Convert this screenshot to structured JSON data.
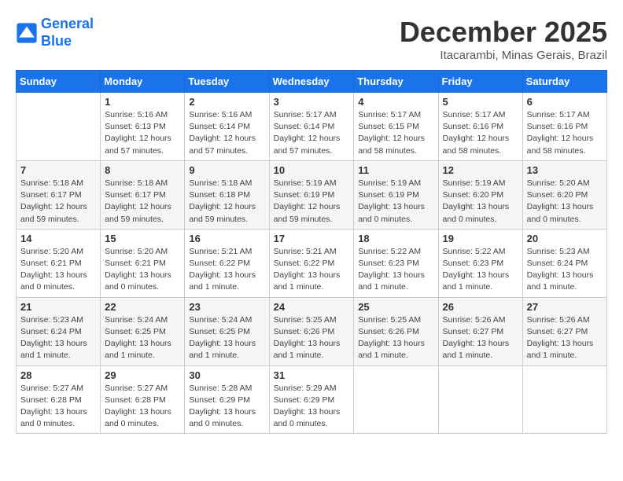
{
  "header": {
    "logo_line1": "General",
    "logo_line2": "Blue",
    "month": "December 2025",
    "location": "Itacarambi, Minas Gerais, Brazil"
  },
  "weekdays": [
    "Sunday",
    "Monday",
    "Tuesday",
    "Wednesday",
    "Thursday",
    "Friday",
    "Saturday"
  ],
  "weeks": [
    [
      {
        "day": "",
        "info": ""
      },
      {
        "day": "1",
        "info": "Sunrise: 5:16 AM\nSunset: 6:13 PM\nDaylight: 12 hours\nand 57 minutes."
      },
      {
        "day": "2",
        "info": "Sunrise: 5:16 AM\nSunset: 6:14 PM\nDaylight: 12 hours\nand 57 minutes."
      },
      {
        "day": "3",
        "info": "Sunrise: 5:17 AM\nSunset: 6:14 PM\nDaylight: 12 hours\nand 57 minutes."
      },
      {
        "day": "4",
        "info": "Sunrise: 5:17 AM\nSunset: 6:15 PM\nDaylight: 12 hours\nand 58 minutes."
      },
      {
        "day": "5",
        "info": "Sunrise: 5:17 AM\nSunset: 6:16 PM\nDaylight: 12 hours\nand 58 minutes."
      },
      {
        "day": "6",
        "info": "Sunrise: 5:17 AM\nSunset: 6:16 PM\nDaylight: 12 hours\nand 58 minutes."
      }
    ],
    [
      {
        "day": "7",
        "info": "Sunrise: 5:18 AM\nSunset: 6:17 PM\nDaylight: 12 hours\nand 59 minutes."
      },
      {
        "day": "8",
        "info": "Sunrise: 5:18 AM\nSunset: 6:17 PM\nDaylight: 12 hours\nand 59 minutes."
      },
      {
        "day": "9",
        "info": "Sunrise: 5:18 AM\nSunset: 6:18 PM\nDaylight: 12 hours\nand 59 minutes."
      },
      {
        "day": "10",
        "info": "Sunrise: 5:19 AM\nSunset: 6:19 PM\nDaylight: 12 hours\nand 59 minutes."
      },
      {
        "day": "11",
        "info": "Sunrise: 5:19 AM\nSunset: 6:19 PM\nDaylight: 13 hours\nand 0 minutes."
      },
      {
        "day": "12",
        "info": "Sunrise: 5:19 AM\nSunset: 6:20 PM\nDaylight: 13 hours\nand 0 minutes."
      },
      {
        "day": "13",
        "info": "Sunrise: 5:20 AM\nSunset: 6:20 PM\nDaylight: 13 hours\nand 0 minutes."
      }
    ],
    [
      {
        "day": "14",
        "info": "Sunrise: 5:20 AM\nSunset: 6:21 PM\nDaylight: 13 hours\nand 0 minutes."
      },
      {
        "day": "15",
        "info": "Sunrise: 5:20 AM\nSunset: 6:21 PM\nDaylight: 13 hours\nand 0 minutes."
      },
      {
        "day": "16",
        "info": "Sunrise: 5:21 AM\nSunset: 6:22 PM\nDaylight: 13 hours\nand 1 minute."
      },
      {
        "day": "17",
        "info": "Sunrise: 5:21 AM\nSunset: 6:22 PM\nDaylight: 13 hours\nand 1 minute."
      },
      {
        "day": "18",
        "info": "Sunrise: 5:22 AM\nSunset: 6:23 PM\nDaylight: 13 hours\nand 1 minute."
      },
      {
        "day": "19",
        "info": "Sunrise: 5:22 AM\nSunset: 6:23 PM\nDaylight: 13 hours\nand 1 minute."
      },
      {
        "day": "20",
        "info": "Sunrise: 5:23 AM\nSunset: 6:24 PM\nDaylight: 13 hours\nand 1 minute."
      }
    ],
    [
      {
        "day": "21",
        "info": "Sunrise: 5:23 AM\nSunset: 6:24 PM\nDaylight: 13 hours\nand 1 minute."
      },
      {
        "day": "22",
        "info": "Sunrise: 5:24 AM\nSunset: 6:25 PM\nDaylight: 13 hours\nand 1 minute."
      },
      {
        "day": "23",
        "info": "Sunrise: 5:24 AM\nSunset: 6:25 PM\nDaylight: 13 hours\nand 1 minute."
      },
      {
        "day": "24",
        "info": "Sunrise: 5:25 AM\nSunset: 6:26 PM\nDaylight: 13 hours\nand 1 minute."
      },
      {
        "day": "25",
        "info": "Sunrise: 5:25 AM\nSunset: 6:26 PM\nDaylight: 13 hours\nand 1 minute."
      },
      {
        "day": "26",
        "info": "Sunrise: 5:26 AM\nSunset: 6:27 PM\nDaylight: 13 hours\nand 1 minute."
      },
      {
        "day": "27",
        "info": "Sunrise: 5:26 AM\nSunset: 6:27 PM\nDaylight: 13 hours\nand 1 minute."
      }
    ],
    [
      {
        "day": "28",
        "info": "Sunrise: 5:27 AM\nSunset: 6:28 PM\nDaylight: 13 hours\nand 0 minutes."
      },
      {
        "day": "29",
        "info": "Sunrise: 5:27 AM\nSunset: 6:28 PM\nDaylight: 13 hours\nand 0 minutes."
      },
      {
        "day": "30",
        "info": "Sunrise: 5:28 AM\nSunset: 6:29 PM\nDaylight: 13 hours\nand 0 minutes."
      },
      {
        "day": "31",
        "info": "Sunrise: 5:29 AM\nSunset: 6:29 PM\nDaylight: 13 hours\nand 0 minutes."
      },
      {
        "day": "",
        "info": ""
      },
      {
        "day": "",
        "info": ""
      },
      {
        "day": "",
        "info": ""
      }
    ]
  ]
}
